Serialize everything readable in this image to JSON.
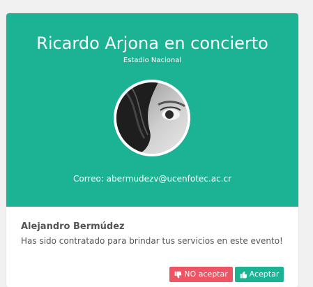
{
  "event": {
    "title": "Ricardo Arjona en concierto",
    "venue": "Estadio Nacional",
    "email_line": "Correo: abermudezv@ucenfotec.ac.cr"
  },
  "notification": {
    "person_name": "Alejandro Bermúdez",
    "message": "Has sido contratado para brindar tus servicios en este evento!"
  },
  "actions": {
    "reject_label": "NO aceptar",
    "accept_label": "Aceptar"
  },
  "colors": {
    "header_bg": "#1bb394",
    "reject_bg": "#ed5565",
    "accept_bg": "#1bb394"
  },
  "icons": {
    "reject": "thumbs-down-icon",
    "accept": "thumbs-up-icon"
  }
}
